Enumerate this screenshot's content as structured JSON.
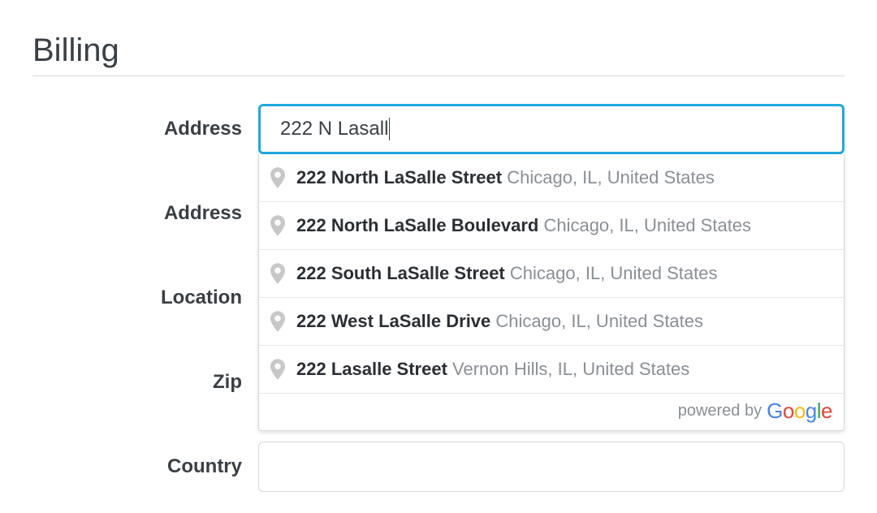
{
  "section": {
    "title": "Billing"
  },
  "form": {
    "address1": {
      "label": "Address",
      "value": "222 N Lasall"
    },
    "address2": {
      "label": "Address",
      "value": ""
    },
    "location": {
      "label": "Location",
      "value": ""
    },
    "zip": {
      "label": "Zip",
      "value": ""
    },
    "country": {
      "label": "Country",
      "value": ""
    }
  },
  "autocomplete": {
    "items": [
      {
        "main": "222 North LaSalle Street",
        "secondary": "Chicago, IL, United States"
      },
      {
        "main": "222 North LaSalle Boulevard",
        "secondary": "Chicago, IL, United States"
      },
      {
        "main": "222 South LaSalle Street",
        "secondary": "Chicago, IL, United States"
      },
      {
        "main": "222 West LaSalle Drive",
        "secondary": "Chicago, IL, United States"
      },
      {
        "main": "222 Lasalle Street",
        "secondary": "Vernon Hills, IL, United States"
      }
    ],
    "footer": "powered by",
    "brand": "Google"
  }
}
